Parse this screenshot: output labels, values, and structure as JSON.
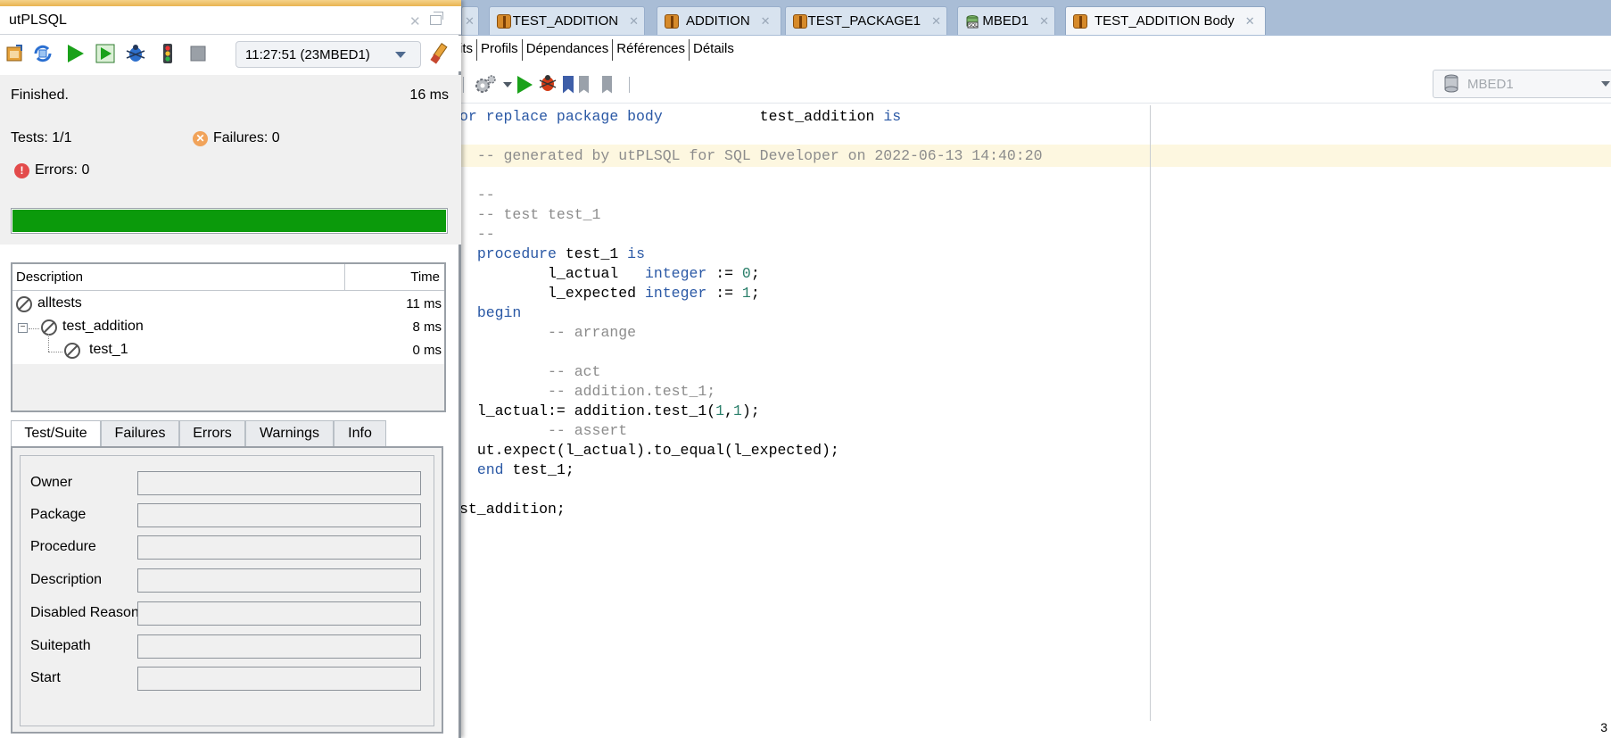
{
  "editor_tabs": [
    {
      "label": "TEST_ADDITION",
      "icon": "package-icon"
    },
    {
      "label": "ADDITION",
      "icon": "package-icon"
    },
    {
      "label": "TEST_PACKAGE1",
      "icon": "package-icon"
    },
    {
      "label": "MBED1",
      "icon": "sql-connection-icon"
    },
    {
      "label": "TEST_ADDITION Body",
      "icon": "package-icon",
      "active": true
    }
  ],
  "code_subtabs": [
    "its",
    "Profils",
    "Dépendances",
    "Références",
    "Détails"
  ],
  "connection": {
    "value": "MBED1"
  },
  "code": {
    "line1_a": "or replace package body",
    "line1_b": "test_addition",
    "line1_c": "is",
    "line2": "-- generated by utPLSQL for SQL Developer on 2022-06-13 14:40:20",
    "line3": "--",
    "line4": "-- test test_1",
    "line5": "--",
    "line6_kw": "procedure",
    "line6_name": "test_1",
    "line6_is": "is",
    "line7_var": "l_actual",
    "line7_type": "integer",
    "line7_assign": ":=",
    "line7_val": "0",
    "line8_var": "l_expected",
    "line8_type": "integer",
    "line8_assign": ":=",
    "line8_val": "1",
    "line9": "begin",
    "line10": "-- arrange",
    "line11": "-- act",
    "line12": "-- addition.test_1;",
    "line13_a": "l_actual:= addition.test_1(",
    "line13_n1": "1",
    "line13_comma": ",",
    "line13_n2": "1",
    "line13_end": ");",
    "line14": "-- assert",
    "line15": "ut.expect(l_actual).to_equal(l_expected);",
    "line16_kw": "end",
    "line16_name": "test_1;",
    "line17": "st_addition;"
  },
  "page_number": "3",
  "panel": {
    "title": "utPLSQL",
    "run_history": "11:27:51 (23MBED1)",
    "status": "Finished.",
    "total_time": "16 ms",
    "tests": "Tests: 1/1",
    "failures": "Failures: 0",
    "errors": "Errors: 0",
    "progress": 1.0,
    "progress_color": "#0b9a0b",
    "table": {
      "col_description": "Description",
      "col_time": "Time",
      "rows": [
        {
          "label": "alltests",
          "time": "11 ms"
        },
        {
          "label": "test_addition",
          "time": "8 ms"
        },
        {
          "label": "test_1",
          "time": "0 ms"
        }
      ]
    },
    "detail_tabs": [
      "Test/Suite",
      "Failures",
      "Errors",
      "Warnings",
      "Info"
    ],
    "fields": [
      {
        "label": "Owner",
        "value": ""
      },
      {
        "label": "Package",
        "value": ""
      },
      {
        "label": "Procedure",
        "value": ""
      },
      {
        "label": "Description",
        "value": ""
      },
      {
        "label": "Disabled Reason",
        "value": ""
      },
      {
        "label": "Suitepath",
        "value": ""
      },
      {
        "label": "Start",
        "value": ""
      }
    ]
  }
}
